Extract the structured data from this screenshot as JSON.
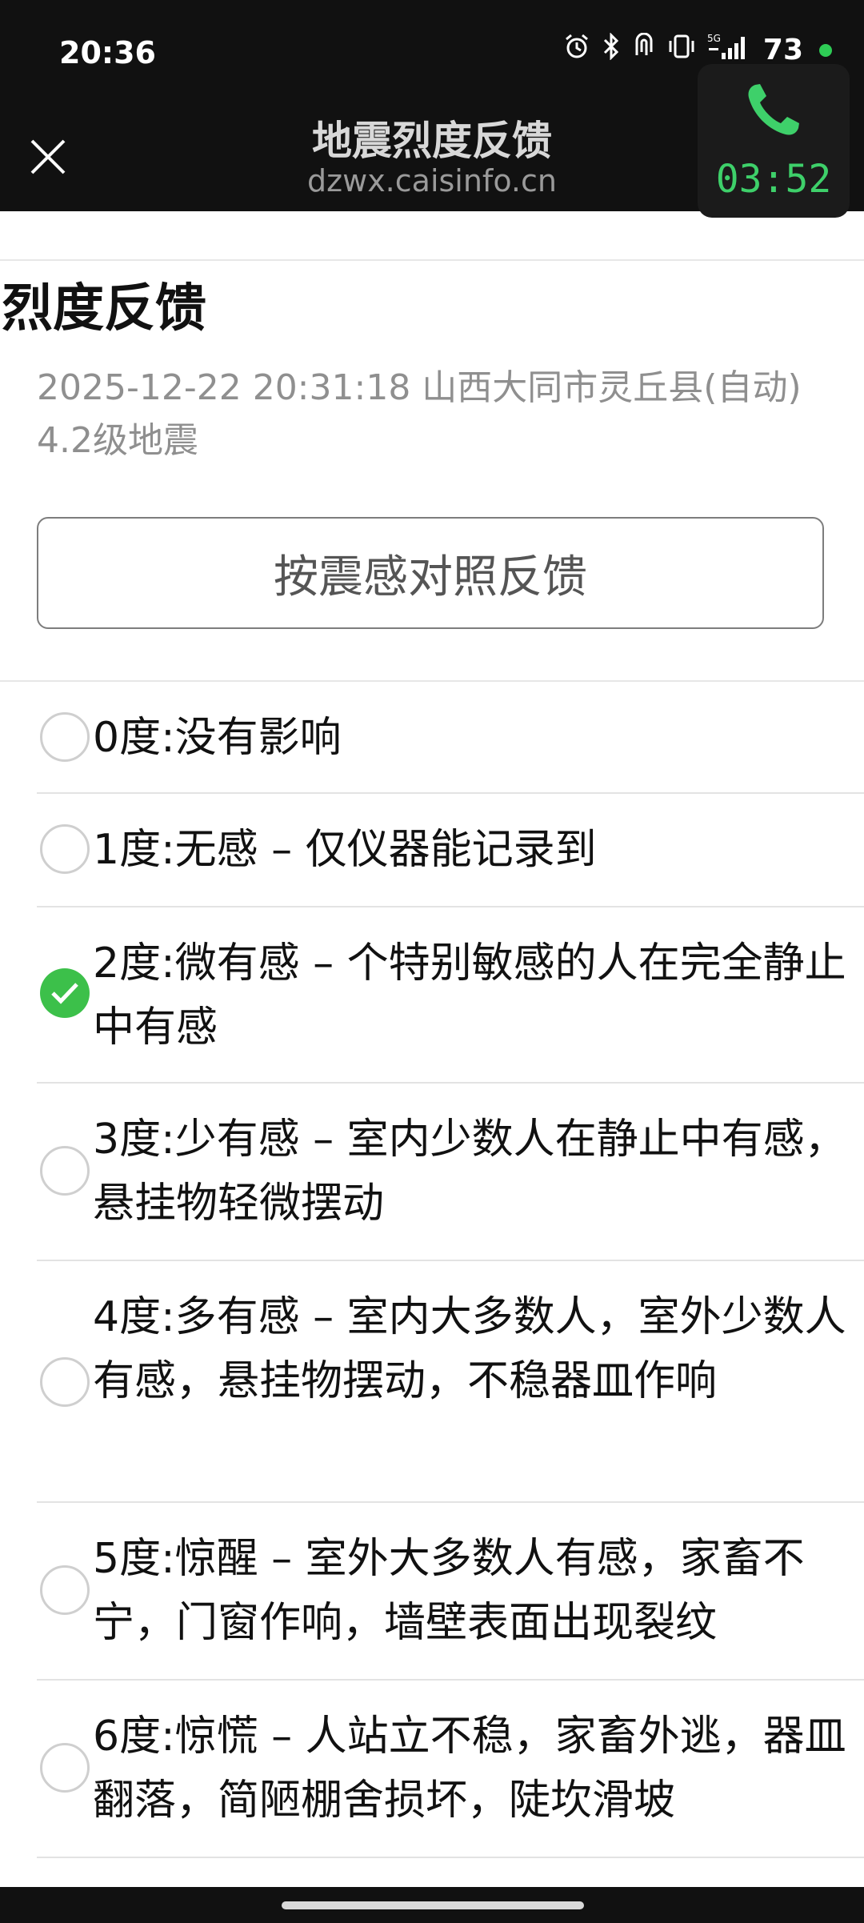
{
  "status_bar": {
    "time": "20:36",
    "battery": "73",
    "icons": [
      "alarm-icon",
      "bluetooth-icon",
      "nfc-icon",
      "vibrate-icon",
      "signal-5g-icon",
      "battery-dot"
    ]
  },
  "title_bar": {
    "title": "地震烈度反馈",
    "url": "dzwx.caisinfo.cn"
  },
  "call": {
    "duration": "03:52"
  },
  "content": {
    "section_title": "烈度反馈",
    "quake_info": "2025-12-22 20:31:18 山西大同市灵丘县(自动) 4.2级地震",
    "feedback_button": "按震感对照反馈"
  },
  "options": [
    {
      "label": "0度:没有影响",
      "checked": false
    },
    {
      "label": "1度:无感 – 仅仪器能记录到",
      "checked": false
    },
    {
      "label": "2度:微有感 – 个特别敏感的人在完全静止中有感",
      "checked": true
    },
    {
      "label": "3度:少有感 – 室内少数人在静止中有感，悬挂物轻微摆动",
      "checked": false
    },
    {
      "label": "4度:多有感 – 室内大多数人，室外少数人有感，悬挂物摆动，不稳器皿作响",
      "checked": false
    },
    {
      "label": "5度:惊醒 – 室外大多数人有感，家畜不宁，门窗作响，墙壁表面出现裂纹",
      "checked": false
    },
    {
      "label": "6度:惊慌 – 人站立不稳，家畜外逃，器皿翻落，简陋棚舍损坏，陡坎滑坡",
      "checked": false
    }
  ],
  "colors": {
    "checked_green": "#3cc04a",
    "call_green": "#3ed06a",
    "dark_bg": "#111111"
  }
}
